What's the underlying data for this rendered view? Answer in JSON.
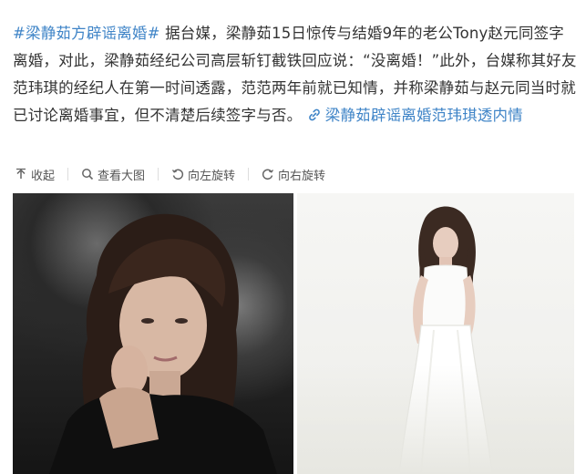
{
  "post": {
    "hashtag": "#梁静茹方辟谣离婚#",
    "body": " 据台媒，梁静茹15日惊传与结婚9年的老公Tony赵元同签字离婚，对此，梁静茹经纪公司高层斩钉截铁回应说：“没离婚！”此外，台媒称其好友范玮琪的经纪人在第一时间透露，范范两年前就已知情，并称梁静茹与赵元同当时就已讨论离婚事宜，但不清楚后续签字与否。",
    "link_text": "梁静茹辟谣离婚范玮琪透内情"
  },
  "toolbar": {
    "collapse": "收起",
    "view_large": "查看大图",
    "rotate_left": "向左旋转",
    "rotate_right": "向右旋转"
  },
  "colors": {
    "link": "#3f84c7",
    "text": "#333333",
    "toolbar_text": "#555555"
  },
  "icons": {
    "collapse": "arrow-up-icon",
    "view_large": "magnifier-icon",
    "rotate_left": "rotate-left-icon",
    "rotate_right": "rotate-right-icon",
    "link": "link-chain-icon"
  }
}
